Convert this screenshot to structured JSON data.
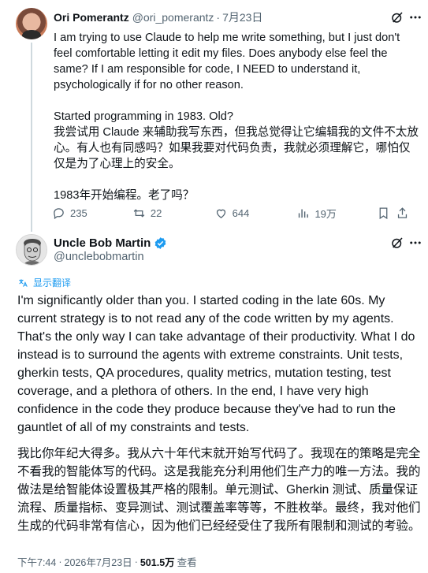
{
  "tweet1": {
    "author_name": "Ori Pomerantz",
    "author_handle": "@ori_pomerantz",
    "separator": "·",
    "date": "7月23日",
    "text_en_1": "I am trying to use Claude to help me write something, but I just don't feel comfortable letting it edit my files. Does anybody else feel the same? If I am responsible for code, I NEED to understand it, psychologically if for no other reason.",
    "text_en_2": "Started programming in 1983. Old?",
    "text_zh_1": "我尝试用 Claude 来辅助我写东西，但我总觉得让它编辑我的文件不太放心。有人也有同感吗？如果我要对代码负责，我就必须理解它，哪怕仅仅是为了心理上的安全。",
    "text_zh_2": "1983年开始编程。老了吗？",
    "replies": "235",
    "reposts": "22",
    "likes": "644",
    "views": "19万",
    "icons": [
      "grok-icon",
      "more-icon",
      "reply-icon",
      "repost-icon",
      "like-icon",
      "views-icon",
      "bookmark-icon",
      "share-icon"
    ]
  },
  "tweet2": {
    "author_name": "Uncle Bob Martin",
    "author_handle": "@unclebobmartin",
    "verified_color": "#1d9bf0",
    "translate_label": "显示翻译",
    "text_en": "I'm significantly older than you. I started coding in the late 60s. My current strategy is to not read any of the code written by my agents. That's the only way I can take advantage of their productivity. What I do instead is to surround the agents with extreme constraints. Unit tests, gherkin tests, QA procedures, quality metrics, mutation testing, test coverage, and a plethora of others. In the end, I have very high confidence in the code they produce because they've had to run the gauntlet of all of my constraints and tests.",
    "text_zh": "我比你年纪大得多。我从六十年代末就开始写代码了。我现在的策略是完全不看我的智能体写的代码。这是我能充分利用他们生产力的唯一方法。我的做法是给智能体设置极其严格的限制。单元测试、Gherkin 测试、质量保证流程、质量指标、变异测试、测试覆盖率等等，不胜枚举。最终，我对他们生成的代码非常有信心，因为他们已经经受住了我所有限制和测试的考验。",
    "time": "下午7:44",
    "separator": "·",
    "date": "2026年7月23日",
    "separator2": "·",
    "views_count": "501.5万",
    "views_label": "查看"
  },
  "colors": {
    "text": "#0f1419",
    "secondary": "#536471",
    "accent": "#1d9bf0",
    "thread_line": "#cfd9de"
  }
}
